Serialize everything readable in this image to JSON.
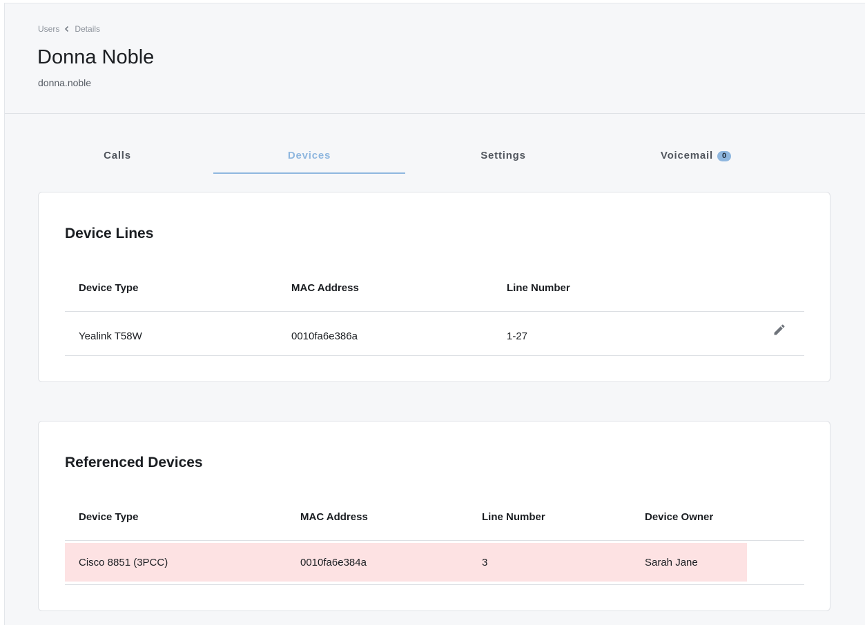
{
  "breadcrumb": {
    "parent": "Users",
    "current": "Details"
  },
  "user": {
    "name": "Donna Noble",
    "username": "donna.noble"
  },
  "tabs": [
    {
      "label": "Calls"
    },
    {
      "label": "Devices",
      "active": true
    },
    {
      "label": "Settings"
    },
    {
      "label": "Voicemail",
      "badge": "0"
    }
  ],
  "device_lines": {
    "title": "Device Lines",
    "columns": [
      "Device Type",
      "MAC Address",
      "Line Number"
    ],
    "rows": [
      {
        "device_type": "Yealink T58W",
        "mac": "0010fa6e386a",
        "line": "1-27"
      }
    ],
    "edit_icon": "pencil-icon"
  },
  "referenced_devices": {
    "title": "Referenced Devices",
    "columns": [
      "Device Type",
      "MAC Address",
      "Line Number",
      "Device Owner"
    ],
    "rows": [
      {
        "device_type": "Cisco 8851 (3PCC)",
        "mac": "0010fa6e384a",
        "line": "3",
        "owner": "Sarah Jane"
      }
    ]
  },
  "colors": {
    "accent": "#8fb7df",
    "highlight_row": "#fde2e3"
  }
}
